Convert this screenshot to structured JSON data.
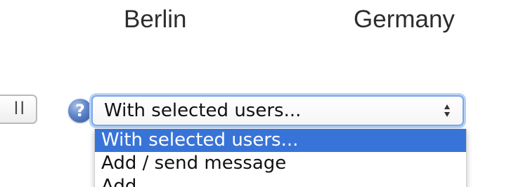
{
  "table_row": {
    "city": "Berlin",
    "country": "Germany"
  },
  "left_button": {
    "label_partial": "ll"
  },
  "help": {
    "icon": "help-question-icon",
    "glyph": "?",
    "color": "#3f68b8"
  },
  "bulk_action_select": {
    "selected_value": "With selected users...",
    "options": [
      "With selected users...",
      "Add / send message",
      "Add ..."
    ],
    "highlight_color": "#3874d8"
  }
}
